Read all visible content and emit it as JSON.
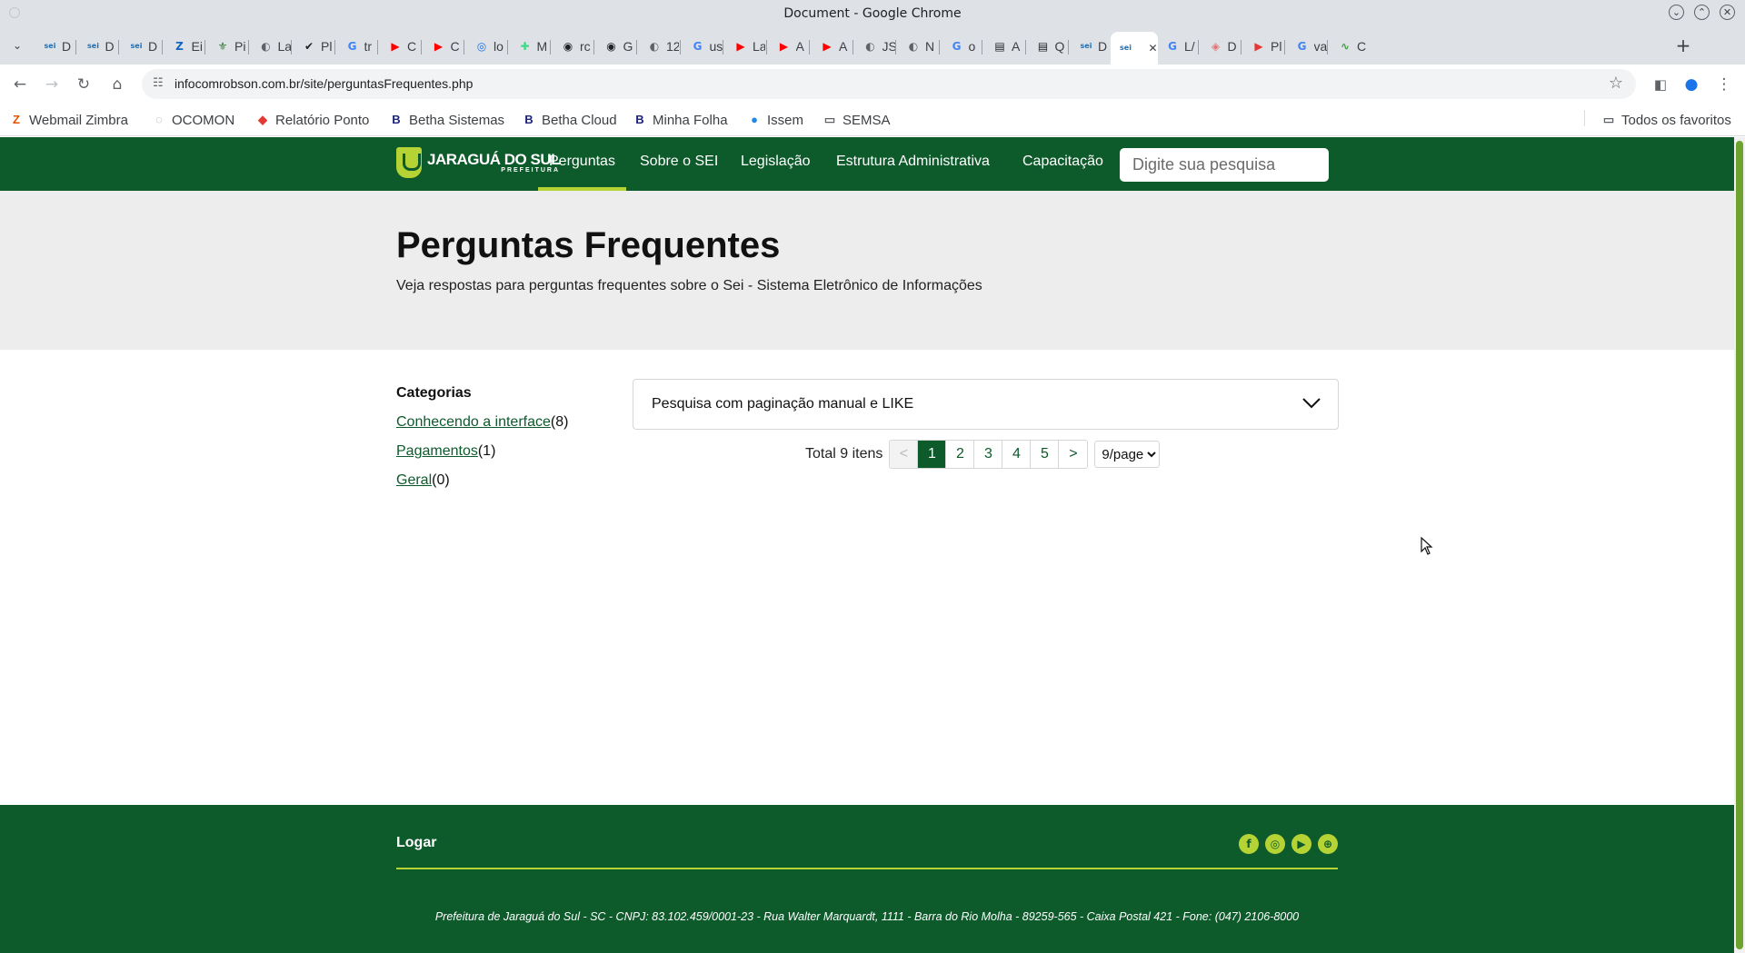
{
  "window": {
    "title": "Document - Google Chrome"
  },
  "tabs": [
    {
      "fav": "sei",
      "label": "D",
      "color": "#1f6fb5"
    },
    {
      "fav": "sei",
      "label": "D",
      "color": "#1f6fb5"
    },
    {
      "fav": "sei",
      "label": "D",
      "color": "#1f6fb5"
    },
    {
      "fav": "Z",
      "label": "Ei",
      "color": "#1565c0"
    },
    {
      "fav": "⚜",
      "label": "Pi",
      "color": "#2e7d32"
    },
    {
      "fav": "◐",
      "label": "La",
      "color": "#5f6368"
    },
    {
      "fav": "✔",
      "label": "Pl",
      "color": "#202124"
    },
    {
      "fav": "G",
      "label": "tr",
      "color": "#4285f4"
    },
    {
      "fav": "▶",
      "label": "C",
      "color": "#ff0000"
    },
    {
      "fav": "▶",
      "label": "C",
      "color": "#ff0000"
    },
    {
      "fav": "◎",
      "label": "lo",
      "color": "#1a73e8"
    },
    {
      "fav": "✚",
      "label": "M",
      "color": "#3ddc84"
    },
    {
      "fav": "◉",
      "label": "rc",
      "color": "#202124"
    },
    {
      "fav": "◉",
      "label": "G",
      "color": "#202124"
    },
    {
      "fav": "◐",
      "label": "12",
      "color": "#5f6368"
    },
    {
      "fav": "G",
      "label": "us",
      "color": "#4285f4"
    },
    {
      "fav": "▶",
      "label": "La",
      "color": "#ff0000"
    },
    {
      "fav": "▶",
      "label": "A",
      "color": "#ff0000"
    },
    {
      "fav": "▶",
      "label": "A",
      "color": "#ff0000"
    },
    {
      "fav": "◐",
      "label": "JS",
      "color": "#5f6368"
    },
    {
      "fav": "◐",
      "label": "N",
      "color": "#5f6368"
    },
    {
      "fav": "G",
      "label": "o",
      "color": "#4285f4"
    },
    {
      "fav": "▤",
      "label": "A",
      "color": "#202124"
    },
    {
      "fav": "▤",
      "label": "Q",
      "color": "#202124"
    },
    {
      "fav": "sei",
      "label": "D",
      "color": "#1f6fb5"
    },
    {
      "fav": "sei",
      "label": "",
      "color": "#1f6fb5",
      "active": true
    },
    {
      "fav": "G",
      "label": "L/",
      "color": "#4285f4"
    },
    {
      "fav": "◈",
      "label": "D",
      "color": "#e57373"
    },
    {
      "fav": "▶",
      "label": "Pl",
      "color": "#e53935"
    },
    {
      "fav": "G",
      "label": "va",
      "color": "#4285f4"
    },
    {
      "fav": "∿",
      "label": "C",
      "color": "#43a047"
    }
  ],
  "toolbar": {
    "url": "infocomrobson.com.br/site/perguntasFrequentes.php"
  },
  "bookmarks": {
    "items": [
      {
        "label": "Webmail Zimbra",
        "icon": "Z",
        "color": "#e65100"
      },
      {
        "label": "OCOMON",
        "icon": "◌",
        "color": "#9e9e9e"
      },
      {
        "label": "Relatório Ponto",
        "icon": "◆",
        "color": "#e53935"
      },
      {
        "label": "Betha Sistemas",
        "icon": "B",
        "color": "#1a237e"
      },
      {
        "label": "Betha Cloud",
        "icon": "B",
        "color": "#1a237e"
      },
      {
        "label": "Minha Folha",
        "icon": "B",
        "color": "#1a237e"
      },
      {
        "label": "Issem",
        "icon": "●",
        "color": "#1e88e5"
      },
      {
        "label": "SEMSA",
        "icon": "folder",
        "color": "#5f6368"
      }
    ],
    "all_label": "Todos os favoritos"
  },
  "site": {
    "logo_line1": "JARAGUÁ DO SUL",
    "logo_line2": "PREFEITURA",
    "menu": [
      "Perguntas",
      "Sobre o SEI",
      "Legislação",
      "Estrutura Administrativa",
      "Capacitação"
    ],
    "active_menu": "Perguntas",
    "search_placeholder": "Digite sua pesquisa",
    "hero": {
      "title": "Perguntas Frequentes",
      "subtitle": "Veja respostas para perguntas frequentes sobre o Sei - Sistema Eletrônico de Informações"
    },
    "categories": {
      "title": "Categorias",
      "items": [
        {
          "name": "Conhecendo a interface",
          "count": "(8)"
        },
        {
          "name": "Pagamentos",
          "count": "(1)"
        },
        {
          "name": "Geral",
          "count": "(0)"
        }
      ]
    },
    "faq": {
      "question": "Pesquisa com paginação manual e LIKE"
    },
    "pagination": {
      "total": "Total 9 itens",
      "prev": "<",
      "pages": [
        "1",
        "2",
        "3",
        "4",
        "5"
      ],
      "current": "1",
      "next": ">",
      "per_page": "9/page"
    },
    "footer": {
      "login": "Logar",
      "socials": [
        "facebook-icon",
        "instagram-icon",
        "youtube-icon",
        "globe-icon"
      ],
      "address": "Prefeitura de Jaraguá do Sul - SC - CNPJ: 83.102.459/0001-23 - Rua Walter Marquardt, 1111 - Barra do Rio Molha - 89259-565 - Caixa Postal 421 - Fone: (047) 2106-8000"
    },
    "colors": {
      "primary": "#0d5a2b",
      "accent": "#b5d334"
    }
  }
}
